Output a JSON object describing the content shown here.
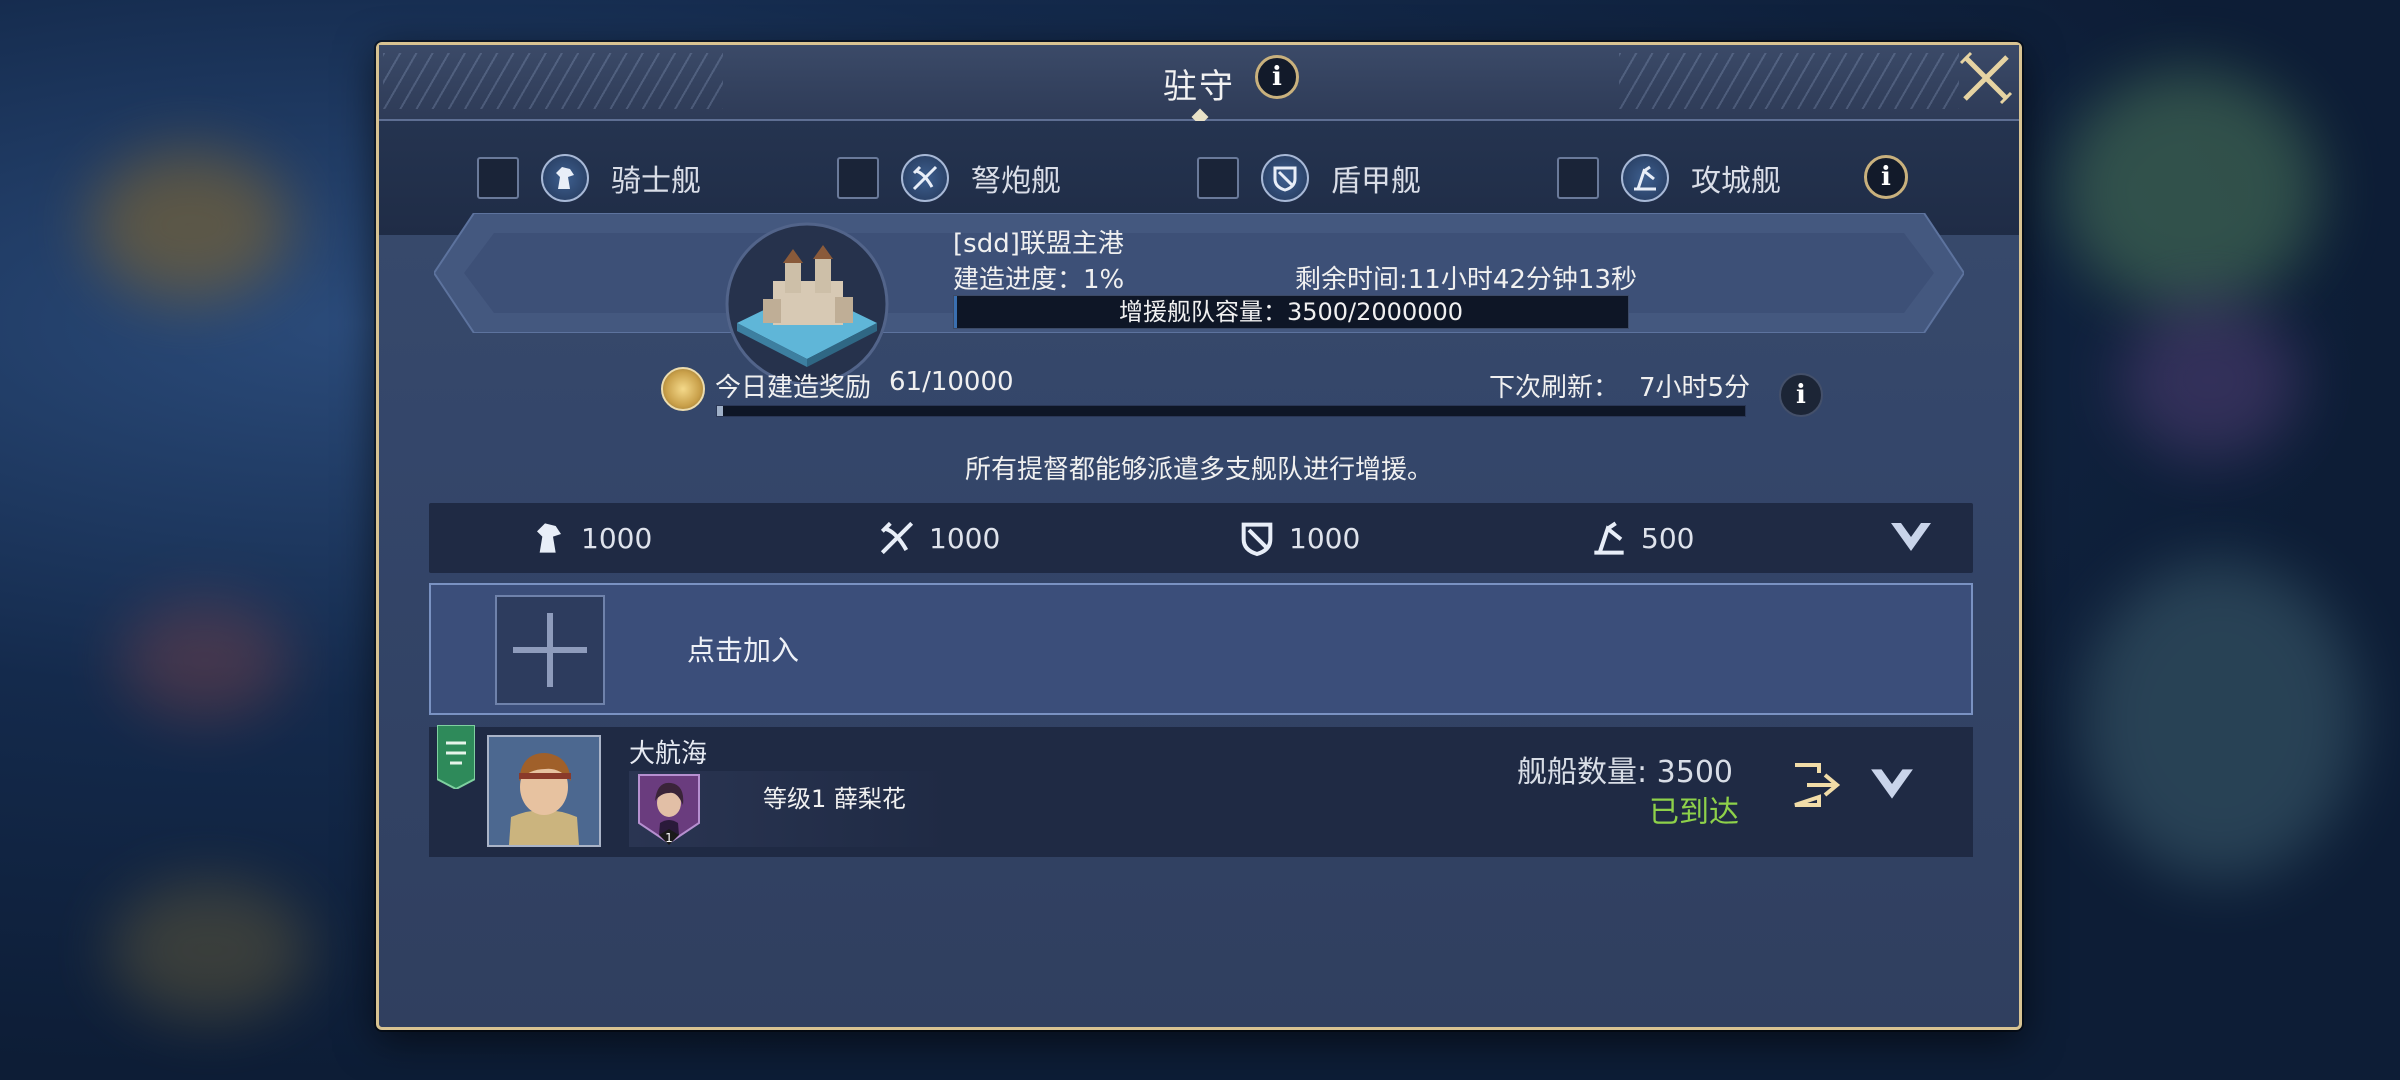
{
  "dialog": {
    "title": "驻守",
    "info_icon": "i"
  },
  "filters": {
    "items": [
      {
        "label": "骑士舰",
        "icon": "knight-ship-icon"
      },
      {
        "label": "弩炮舰",
        "icon": "ballista-ship-icon"
      },
      {
        "label": "盾甲舰",
        "icon": "shield-ship-icon"
      },
      {
        "label": "攻城舰",
        "icon": "siege-ship-icon"
      }
    ],
    "info_icon": "i"
  },
  "base": {
    "name": "[sdd]联盟主港",
    "progress_text": "建造进度：1%",
    "remaining_text": "剩余时间:11小时42分钟13秒",
    "capacity_text": "增援舰队容量：3500/2000000",
    "capacity_fraction": 0.00175
  },
  "reward": {
    "label": "今日建造奖励",
    "value": "61/10000",
    "fraction": 0.0061,
    "refresh_label": "下次刷新：",
    "refresh_value": "7小时5分",
    "info_icon": "i"
  },
  "notice": "所有提督都能够派遣多支舰队进行增援。",
  "limits": [
    {
      "icon": "knight-ship-icon",
      "value": "1000"
    },
    {
      "icon": "ballista-ship-icon",
      "value": "1000"
    },
    {
      "icon": "shield-ship-icon",
      "value": "1000"
    },
    {
      "icon": "siege-ship-icon",
      "value": "500"
    }
  ],
  "add_slot": {
    "label": "点击加入"
  },
  "fleet": {
    "player_name": "大航海",
    "hero_text": "等级1 薛梨花",
    "hero_level": "1",
    "ship_count": "舰船数量: 3500",
    "status": "已到达"
  },
  "colors": {
    "gold_border": "#d8c392",
    "arrived_green": "#8ed14a",
    "panel_dark": "#1f2a44",
    "add_slot_blue": "#3b4e7a"
  }
}
